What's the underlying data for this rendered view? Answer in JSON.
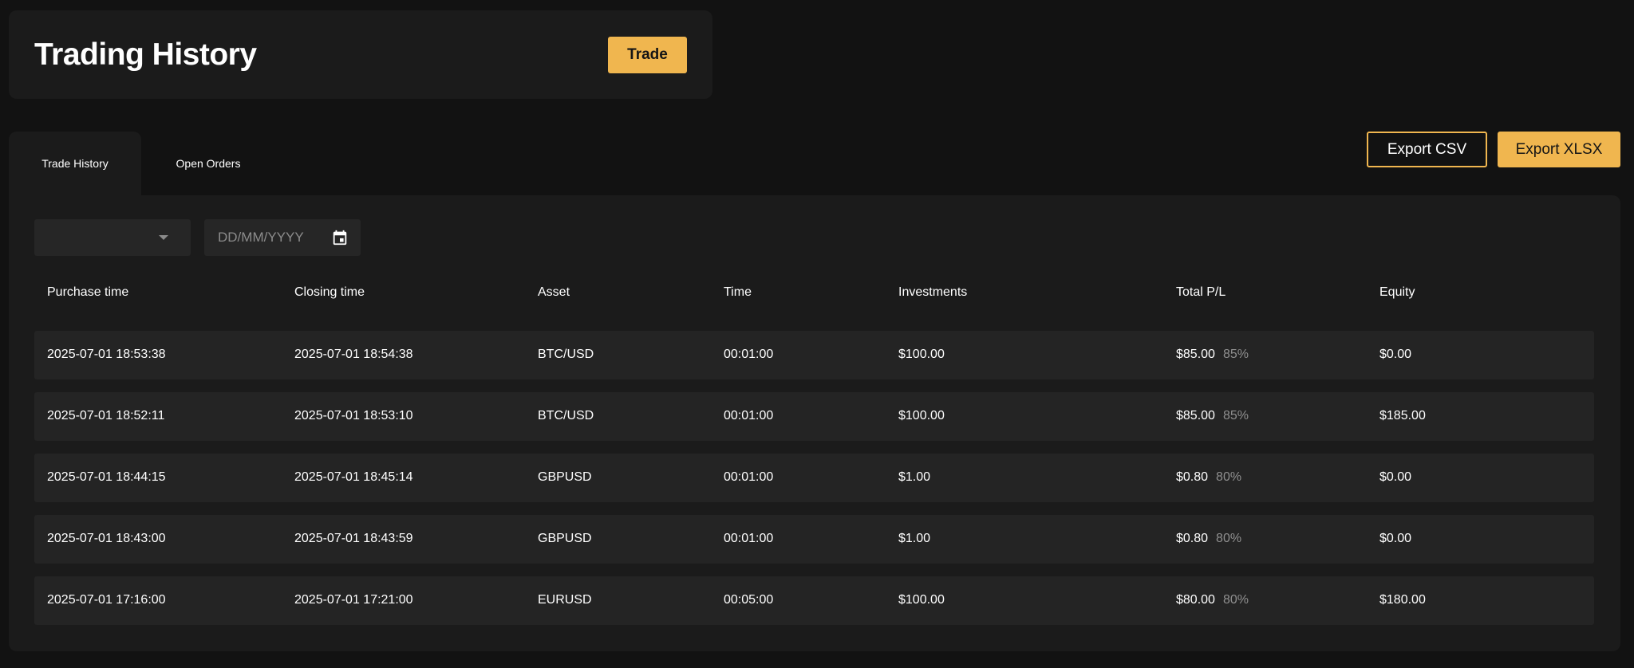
{
  "header": {
    "title": "Trading History",
    "trade_label": "Trade"
  },
  "tabs": [
    {
      "label": "Trade History",
      "active": true
    },
    {
      "label": "Open Orders",
      "active": false
    }
  ],
  "export": {
    "csv_label": "Export CSV",
    "xlsx_label": "Export XLSX"
  },
  "filters": {
    "select_value": "",
    "date_placeholder": "DD/MM/YYYY"
  },
  "table": {
    "columns": [
      "Purchase time",
      "Closing time",
      "Asset",
      "Time",
      "Investments",
      "Total P/L",
      "Equity"
    ],
    "rows": [
      {
        "purchase": "2025-07-01 18:53:38",
        "closing": "2025-07-01 18:54:38",
        "asset": "BTC/USD",
        "time": "00:01:00",
        "investment": "$100.00",
        "pl": "$85.00",
        "pl_pct": "85%",
        "equity": "$0.00"
      },
      {
        "purchase": "2025-07-01 18:52:11",
        "closing": "2025-07-01 18:53:10",
        "asset": "BTC/USD",
        "time": "00:01:00",
        "investment": "$100.00",
        "pl": "$85.00",
        "pl_pct": "85%",
        "equity": "$185.00"
      },
      {
        "purchase": "2025-07-01 18:44:15",
        "closing": "2025-07-01 18:45:14",
        "asset": "GBPUSD",
        "time": "00:01:00",
        "investment": "$1.00",
        "pl": "$0.80",
        "pl_pct": "80%",
        "equity": "$0.00"
      },
      {
        "purchase": "2025-07-01 18:43:00",
        "closing": "2025-07-01 18:43:59",
        "asset": "GBPUSD",
        "time": "00:01:00",
        "investment": "$1.00",
        "pl": "$0.80",
        "pl_pct": "80%",
        "equity": "$0.00"
      },
      {
        "purchase": "2025-07-01 17:16:00",
        "closing": "2025-07-01 17:21:00",
        "asset": "EURUSD",
        "time": "00:05:00",
        "investment": "$100.00",
        "pl": "$80.00",
        "pl_pct": "80%",
        "equity": "$180.00"
      }
    ]
  },
  "icons": {
    "calendar": "calendar-icon",
    "dropdown": "chevron-down-icon"
  },
  "colors": {
    "accent": "#f0b64f",
    "background": "#121212",
    "panel": "#1b1b1b",
    "row": "#242424",
    "muted": "#8f8f8f"
  }
}
